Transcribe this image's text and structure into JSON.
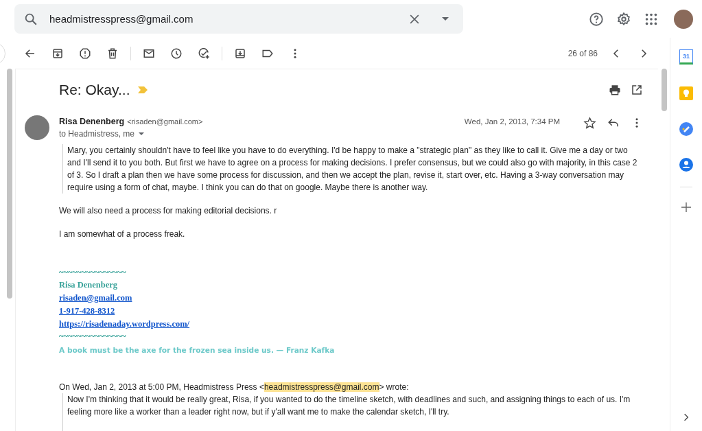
{
  "search": {
    "value": "headmistresspress@gmail.com"
  },
  "toolbar": {
    "counter": "26 of 86"
  },
  "message": {
    "subject": "Re: Okay...",
    "important": true,
    "sender_name": "Risa Denenberg",
    "sender_email": "<risaden@gmail.com>",
    "recipients": "to Headmistress, me",
    "date": "Wed, Jan 2, 2013, 7:34 PM",
    "starred": false,
    "paragraphs": [
      "Mary, you certainly shouldn't have to feel like you have to do everything. I'd  be happy to make a \"strategic plan\" as they like to call it. Give me a day or two and I'll send it to you both. But first we have to agree on a process for making decisions. I prefer consensus, but we could also go with majority, in this case 2 of 3.  So I draft a plan then we have some process for discussion, and then we accept the plan, revise it, start over, etc.  Having a 3-way conversation may require using a form of chat, maybe. I think you can do that on google. Maybe there is another way."
    ],
    "body": [
      "We will also need a process for making editorial decisions. r",
      "I am somewhat of a process freak."
    ],
    "signature": [
      {
        "kind": "rule",
        "text": "~~~~~~~~~~~~~~~"
      },
      {
        "kind": "name",
        "text": "Risa Denenberg"
      },
      {
        "kind": "link",
        "text": "risaden@gmail.com"
      },
      {
        "kind": "link",
        "text": "1-917-428-8312"
      },
      {
        "kind": "link",
        "text": "https://risadenaday.wordpress.com/"
      },
      {
        "kind": "rule",
        "text": "~~~~~~~~~~~~~~~"
      },
      {
        "kind": "quote",
        "text": "A book must be the axe for the frozen sea inside us.  — Franz Kafka"
      }
    ],
    "quoted": {
      "attribution_prefix": "On Wed, Jan 2, 2013 at 5:00 PM, Headmistress Press <",
      "attribution_email": "headmistresspress@gmail.com",
      "attribution_suffix": "> wrote:",
      "text": "Now I'm thinking that it would be really great, Risa, if you wanted to do the timeline sketch, with deadlines and such, and assigning things to each of us. I'm feeling more like a worker than a leader right now, but if y'all want me to make the calendar sketch, I'll try."
    }
  },
  "side_panel": {
    "calendar_day": "31"
  }
}
